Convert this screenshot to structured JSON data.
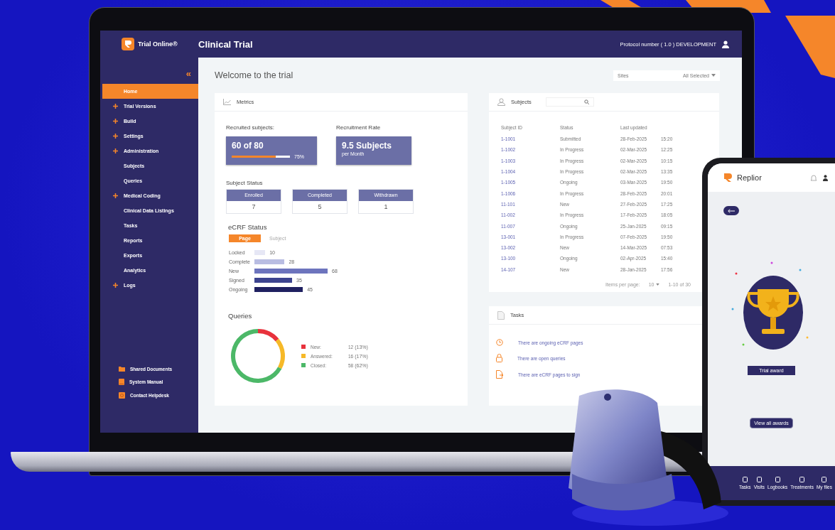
{
  "header": {
    "brand": "Trial Online®",
    "title": "Clinical Trial",
    "protocol": "Protocol number ( 1.0 ) DEVELOPMENT"
  },
  "sidebar": {
    "collapse": "«",
    "items": [
      {
        "label": "Home",
        "expandable": false,
        "selected": true
      },
      {
        "label": "Trial Versions",
        "expandable": true,
        "selected": false
      },
      {
        "label": "Build",
        "expandable": true,
        "selected": false
      },
      {
        "label": "Settings",
        "expandable": true,
        "selected": false
      },
      {
        "label": "Administration",
        "expandable": true,
        "selected": false
      },
      {
        "label": "Subjects",
        "expandable": false,
        "selected": false
      },
      {
        "label": "Queries",
        "expandable": false,
        "selected": false
      },
      {
        "label": "Medical Coding",
        "expandable": true,
        "selected": false
      },
      {
        "label": "Clinical Data Listings",
        "expandable": false,
        "selected": false
      },
      {
        "label": "Tasks",
        "expandable": false,
        "selected": false
      },
      {
        "label": "Reports",
        "expandable": false,
        "selected": false
      },
      {
        "label": "Exports",
        "expandable": false,
        "selected": false
      },
      {
        "label": "Analytics",
        "expandable": false,
        "selected": false
      },
      {
        "label": "Logs",
        "expandable": true,
        "selected": false
      }
    ],
    "links": [
      {
        "label": "Shared Documents",
        "kind": "folder"
      },
      {
        "label": "System Manual",
        "kind": "book"
      },
      {
        "label": "Contact Helpdesk",
        "kind": "help"
      }
    ]
  },
  "page": {
    "title": "Welcome to the trial",
    "sites": {
      "label": "Sites",
      "value": "All Selected"
    }
  },
  "metrics": {
    "title": "Metrics",
    "recruited": {
      "label": "Recruited subjects:",
      "value": "60 of 80",
      "level": 0.75,
      "percent": "75%"
    },
    "rate": {
      "label": "Recruitment Rate",
      "value": "9.5 Subjects",
      "unit": "per Month"
    },
    "subject_status": {
      "title": "Subject Status",
      "items": [
        {
          "label": "Enrolled",
          "value": "7"
        },
        {
          "label": "Completed",
          "value": "5"
        },
        {
          "label": "Withdrawn",
          "value": "1"
        }
      ]
    },
    "ecrf": {
      "title": "eCRF Status",
      "tabs": [
        {
          "label": "Page",
          "selected": true
        },
        {
          "label": "Subject",
          "selected": false
        }
      ],
      "chart_data": {
        "type": "bar",
        "orientation": "horizontal",
        "categories": [
          "Locked",
          "Complete",
          "New",
          "Signed",
          "Ongoing"
        ],
        "values": [
          10,
          28,
          68,
          35,
          45
        ],
        "data_labels": true
      }
    },
    "queries": {
      "title": "Queries",
      "chart_data": {
        "type": "donut",
        "categories": [
          "New",
          "Answered",
          "Closed"
        ],
        "values": [
          14,
          19,
          67
        ]
      },
      "label_separator": ":",
      "legend": [
        {
          "value": "12",
          "percent": "(13%)",
          "color": "#e8323c"
        },
        {
          "value": "16",
          "percent": "(17%)",
          "color": "#f6b928"
        },
        {
          "value": "58",
          "percent": "(62%)",
          "color": "#4cb868"
        }
      ]
    }
  },
  "subjects": {
    "title": "Subjects",
    "columns": [
      "Subject ID",
      "Status",
      "Last updated"
    ],
    "rows": [
      [
        "1-1001",
        "Submitted",
        "28-Feb-2025",
        "15:20"
      ],
      [
        "1-1002",
        "In Progress",
        "02-Mar-2025",
        "12:25"
      ],
      [
        "1-1003",
        "In Progress",
        "02-Mar-2025",
        "10:15"
      ],
      [
        "1-1004",
        "In Progress",
        "02-Mar-2025",
        "13:35"
      ],
      [
        "1-1005",
        "Ongoing",
        "03-Mar-2025",
        "19:50"
      ],
      [
        "1-1006",
        "In Progress",
        "28-Feb-2025",
        "20:01"
      ],
      [
        "11-101",
        "New",
        "27-Feb-2025",
        "17:25"
      ],
      [
        "11-002",
        "In Progress",
        "17-Feb-2025",
        "18:05"
      ],
      [
        "11-007",
        "Ongoing",
        "25-Jan-2025",
        "09:15"
      ],
      [
        "13-001",
        "In Progress",
        "07-Feb-2025",
        "19:50"
      ],
      [
        "13-002",
        "New",
        "14-Mar-2025",
        "07:53"
      ],
      [
        "13-100",
        "Ongoing",
        "02-Apr-2025",
        "15:40"
      ],
      [
        "14-107",
        "New",
        "28-Jan-2025",
        "17:56"
      ]
    ],
    "pagination": {
      "label": "Items per page:",
      "per_page": "10",
      "range": "1-10 of 30"
    }
  },
  "tasks": {
    "title": "Tasks",
    "items": [
      {
        "kind": "clock",
        "text": "There are ongoing eCRF pages"
      },
      {
        "kind": "lock",
        "text": "There are open queries"
      },
      {
        "kind": "sign",
        "text": "There are eCRF pages to sign"
      }
    ]
  },
  "phone": {
    "brand": "Replior",
    "award": "Trial award",
    "button": "View all awards",
    "nav": [
      "Tasks",
      "Visits",
      "Logbooks",
      "Treatments",
      "My files"
    ]
  }
}
